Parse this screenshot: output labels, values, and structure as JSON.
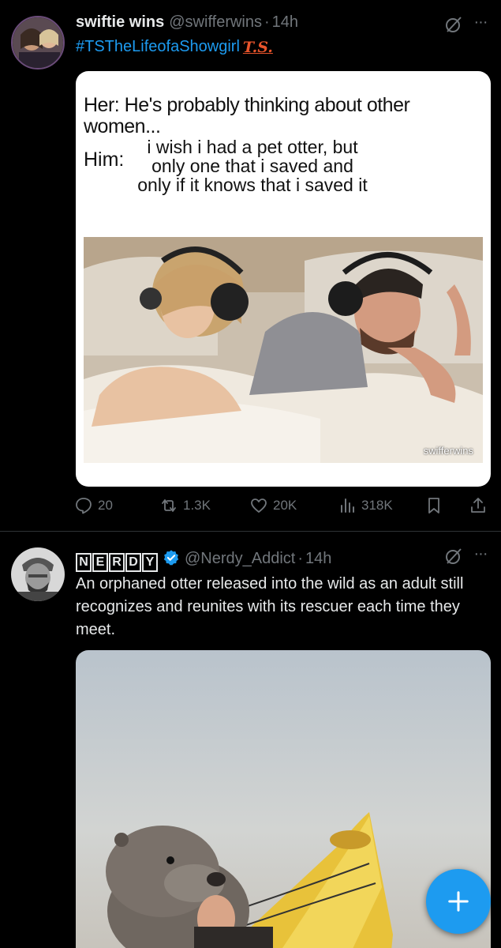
{
  "post1": {
    "display_name": "swiftie wins",
    "handle": "@swifferwins",
    "time": "14h",
    "hashtag": "#TSTheLifeofaShowgirl",
    "hashtag_badge": "T.S.",
    "meme": {
      "her_line": "Her: He's probably thinking about other women...",
      "him_label": "Him:",
      "him_line": "i wish i had a pet otter, but only one that i saved and only if it knows that i saved it",
      "watermark": "swifferwins"
    },
    "actions": {
      "replies": "20",
      "reposts": "1.3K",
      "likes": "20K",
      "views": "318K"
    }
  },
  "post2": {
    "display_name_logo": [
      "N",
      "E",
      "R",
      "D",
      "Y"
    ],
    "handle": "@Nerdy_Addict",
    "time": "14h",
    "text": "An orphaned otter released into the wild as an adult still recognizes and reunites with its rescuer each time they meet."
  },
  "separator": "·",
  "more_label": "···",
  "colors": {
    "background": "#000000",
    "text": "#e7e9ea",
    "muted": "#71767b",
    "accent": "#1d9bf0",
    "badge": "#e8542b"
  },
  "icons": {
    "grok": "grok-icon",
    "reply": "reply-icon",
    "repost": "repost-icon",
    "like": "heart-icon",
    "views": "views-icon",
    "bookmark": "bookmark-icon",
    "share": "share-icon",
    "verified": "verified-badge-icon",
    "compose": "plus-icon"
  }
}
